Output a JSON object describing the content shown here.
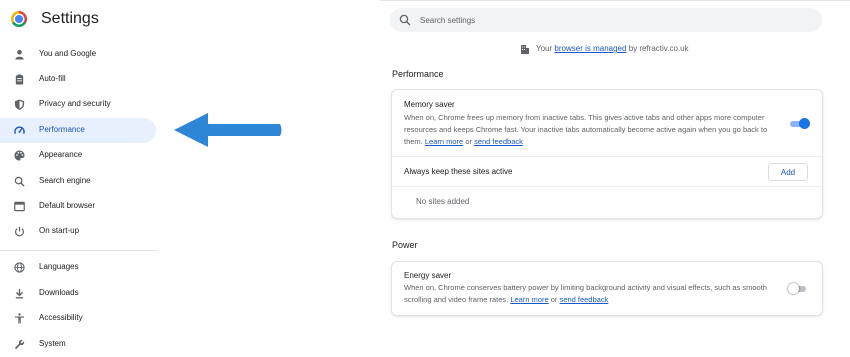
{
  "header": {
    "title": "Settings"
  },
  "search": {
    "placeholder": "Search settings"
  },
  "managed": {
    "prefix": "Your",
    "link": "browser is managed",
    "suffix": "by refractiv.co.uk"
  },
  "sidebar": {
    "items": [
      {
        "label": "You and Google",
        "icon": "person-icon"
      },
      {
        "label": "Auto-fill",
        "icon": "clipboard-icon"
      },
      {
        "label": "Privacy and security",
        "icon": "shield-icon"
      },
      {
        "label": "Performance",
        "icon": "speedometer-icon",
        "selected": true
      },
      {
        "label": "Appearance",
        "icon": "palette-icon"
      },
      {
        "label": "Search engine",
        "icon": "search-icon"
      },
      {
        "label": "Default browser",
        "icon": "browser-window-icon"
      },
      {
        "label": "On start-up",
        "icon": "power-icon"
      },
      {
        "label": "Languages",
        "icon": "globe-icon"
      },
      {
        "label": "Downloads",
        "icon": "download-icon"
      },
      {
        "label": "Accessibility",
        "icon": "accessibility-icon"
      },
      {
        "label": "System",
        "icon": "wrench-icon"
      }
    ]
  },
  "performance": {
    "title": "Performance",
    "memory_saver": {
      "title": "Memory saver",
      "description": "When on, Chrome frees up memory from inactive tabs. This gives active tabs and other apps more computer resources and keeps Chrome fast. Your inactive tabs automatically become active again when you go back to them.",
      "learn_more": "Learn more",
      "or": "or",
      "send_feedback": "send feedback",
      "enabled": true
    },
    "always_active": {
      "label": "Always keep these sites active",
      "add_label": "Add",
      "empty_text": "No sites added"
    }
  },
  "power": {
    "title": "Power",
    "energy_saver": {
      "title": "Energy saver",
      "description": "When on, Chrome conserves battery power by limiting background activity and visual effects, such as smooth scrolling and video frame rates.",
      "learn_more": "Learn more",
      "or": "or",
      "send_feedback": "send feedback",
      "enabled": false
    }
  },
  "colors": {
    "accent": "#1a73e8",
    "selected_bg": "#e8f0fe",
    "link": "#1a57c7",
    "annotation_arrow": "#2e86d6"
  }
}
